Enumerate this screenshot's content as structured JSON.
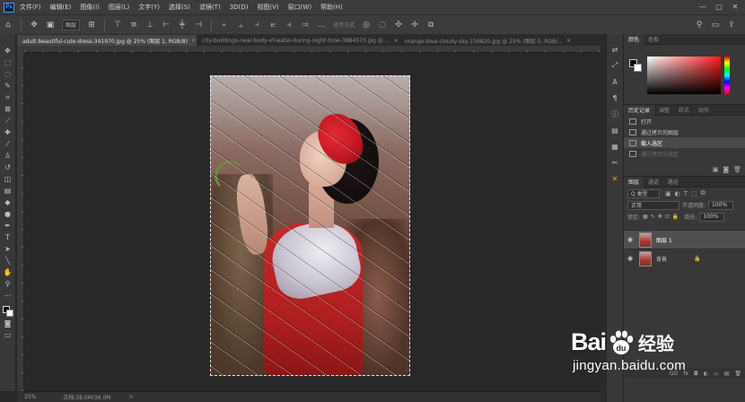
{
  "app": {
    "logo": "Ps"
  },
  "menubar": {
    "items": [
      "文件(F)",
      "编辑(E)",
      "图像(I)",
      "图层(L)",
      "文字(Y)",
      "选择(S)",
      "滤镜(T)",
      "3D(D)",
      "视图(V)",
      "窗口(W)",
      "帮助(H)"
    ],
    "window_controls": [
      "—",
      "▢",
      "✕"
    ]
  },
  "options": {
    "mode_select": "图层",
    "text": "对齐方式"
  },
  "tabs": [
    {
      "label": "adult-beautiful-cute-dress-341970.jpg @ 25% (图层 1, RGB/8)",
      "close": "×",
      "active": true
    },
    {
      "label": "city-buildings-near-body-of-water-during-night-time-3884573.jpg @ ...",
      "close": "×",
      "active": false
    },
    {
      "label": "orange-blue-cloudy-sky-159820.jpg @ 25% (图层 0, RGB/...",
      "close": "×",
      "active": false
    }
  ],
  "status": {
    "zoom": "25%",
    "doc": "文档:38.0M/36.0M",
    "arrow": ">"
  },
  "panels": {
    "color_tabs": [
      "颜色",
      "色板"
    ],
    "history_tabs": [
      "历史记录",
      "调整",
      "样式",
      "动作"
    ],
    "history_items": [
      "打开",
      "通过拷贝的图层",
      "载入选区",
      "通过拷贝的选区"
    ],
    "layers_tabs": [
      "图层",
      "通道",
      "路径"
    ],
    "kind_select": "Q 类型",
    "blend_select": "正常",
    "opacity_label": "不透明度:",
    "opacity_value": "100%",
    "lock_label": "锁定:",
    "fill_label": "填充:",
    "fill_value": "100%",
    "layers": [
      {
        "name": "图层 1",
        "selected": true
      },
      {
        "name": "背景",
        "selected": false
      }
    ],
    "footer_icons": [
      "GO",
      "fx",
      "◘",
      "◐",
      "▭",
      "▤",
      "🗑"
    ]
  },
  "watermark": {
    "brand": "Bai",
    "brand2": "du",
    "product": "经验",
    "url": "jingyan.baidu.com"
  }
}
